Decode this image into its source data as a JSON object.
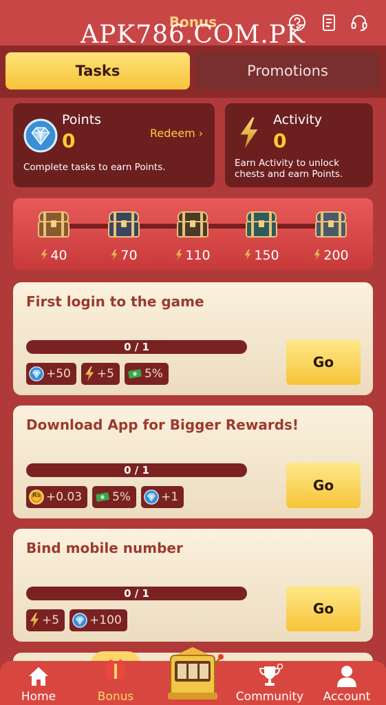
{
  "header": {
    "title": "Bonus",
    "watermark": "APK786.COM.PK"
  },
  "tabs": [
    {
      "label": "Tasks",
      "active": true
    },
    {
      "label": "Promotions",
      "active": false
    }
  ],
  "points": {
    "title": "Points",
    "value": "0",
    "redeem_label": "Redeem",
    "description": "Complete tasks to earn Points."
  },
  "activity": {
    "title": "Activity",
    "value": "0",
    "description_line1": "Earn Activity to unlock",
    "description_line2": "chests and earn Points."
  },
  "chests": [
    {
      "label": "40",
      "color": "#8a5a2e"
    },
    {
      "label": "70",
      "color": "#3a4660"
    },
    {
      "label": "110",
      "color": "#4a3a2a"
    },
    {
      "label": "150",
      "color": "#2e5a5a"
    },
    {
      "label": "200",
      "color": "#4a5a6a"
    }
  ],
  "tasks": [
    {
      "title": "First login to the game",
      "progress": "0 / 1",
      "go_label": "Go",
      "rewards": [
        {
          "icon": "diamond-icon",
          "text": "+50"
        },
        {
          "icon": "bolt-icon",
          "text": "+5"
        },
        {
          "icon": "cash-icon",
          "text": "5%"
        }
      ]
    },
    {
      "title": "Download App for Bigger Rewards!",
      "progress": "0 / 1",
      "go_label": "Go",
      "rewards": [
        {
          "icon": "coin-icon",
          "text": "+0.03"
        },
        {
          "icon": "cash-icon",
          "text": "5%"
        },
        {
          "icon": "diamond-icon",
          "text": "+1"
        }
      ]
    },
    {
      "title": "Bind mobile number",
      "progress": "0 / 1",
      "go_label": "Go",
      "rewards": [
        {
          "icon": "bolt-icon",
          "text": "+5"
        },
        {
          "icon": "diamond-icon",
          "text": "+100"
        }
      ]
    }
  ],
  "nav": {
    "home": "Home",
    "bonus": "Bonus",
    "community": "Community",
    "account": "Account"
  },
  "coin_symbol": "Rs",
  "colors": {
    "background": "#b03a3a",
    "accent_gold": "#ffce2e",
    "card_dark": "#6c1f1f",
    "task_card": "#fbf1dd",
    "task_title": "#9b3a30"
  }
}
